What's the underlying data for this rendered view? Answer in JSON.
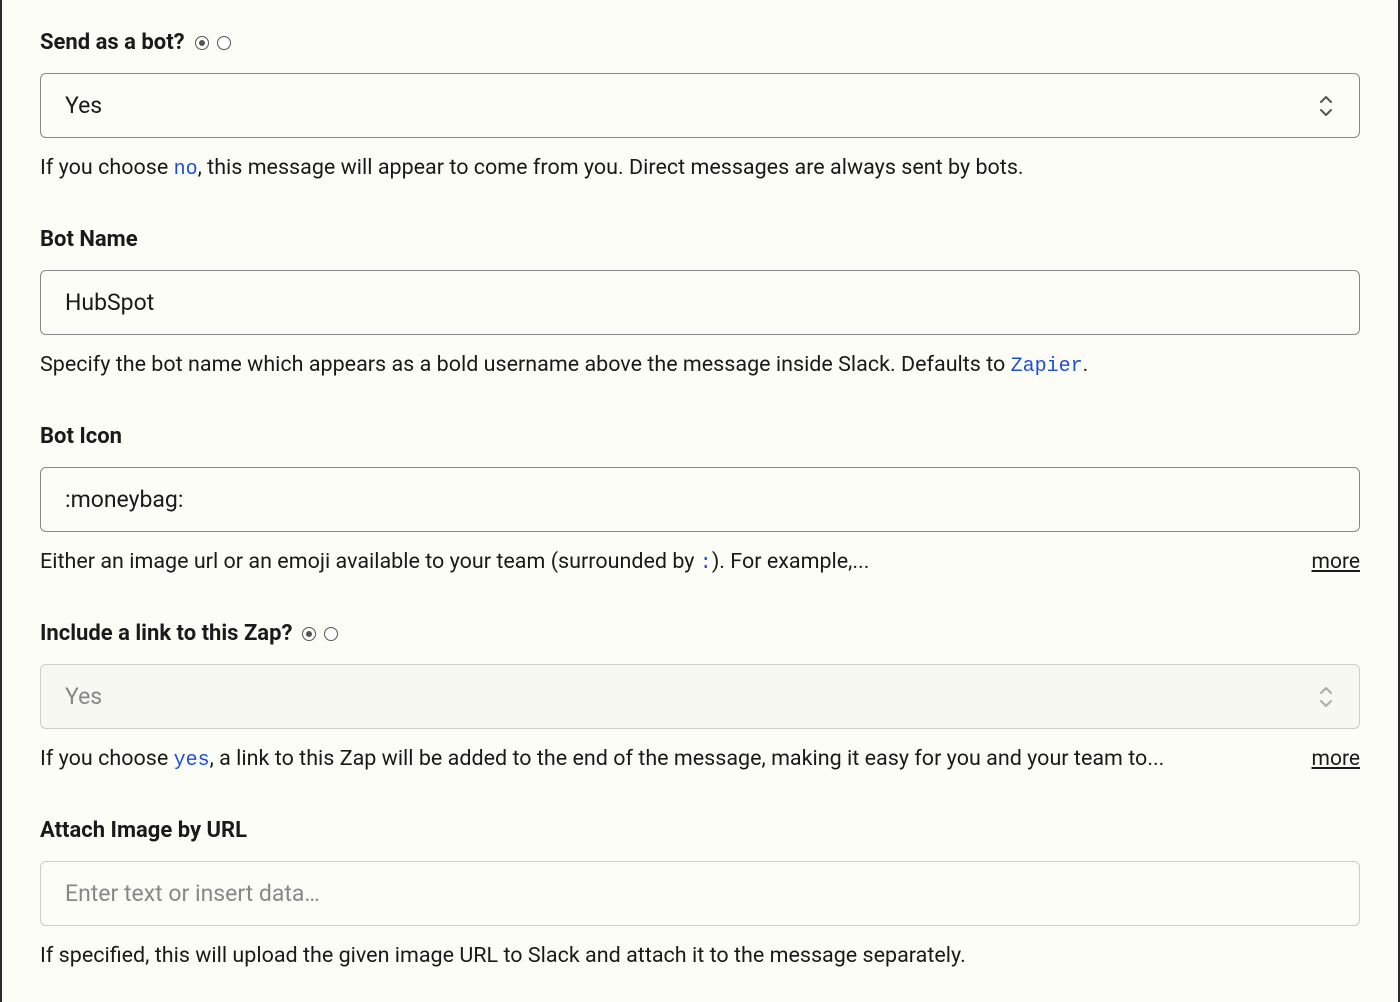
{
  "sendAsBot": {
    "label": "Send as a bot?",
    "value": "Yes",
    "helpPrefix": "If you choose ",
    "helpCode": "no",
    "helpSuffix": ", this message will appear to come from you. Direct messages are always sent by bots."
  },
  "botName": {
    "label": "Bot Name",
    "value": "HubSpot",
    "helpPrefix": "Specify the bot name which appears as a bold username above the message inside Slack. Defaults to ",
    "helpCode": "Zapier",
    "helpSuffix": "."
  },
  "botIcon": {
    "label": "Bot Icon",
    "value": ":moneybag:",
    "helpPrefix": "Either an image url or an emoji available to your team (surrounded by ",
    "helpCode": ":",
    "helpSuffix": "). For example,...",
    "moreLabel": "more"
  },
  "includeLink": {
    "label": "Include a link to this Zap?",
    "value": "Yes",
    "helpPrefix": "If you choose ",
    "helpCode": "yes",
    "helpSuffix": ", a link to this Zap will be added to the end of the message, making it easy for you and your team to...",
    "moreLabel": "more"
  },
  "attachImage": {
    "label": "Attach Image by URL",
    "placeholder": "Enter text or insert data…",
    "help": "If specified, this will upload the given image URL to Slack and attach it to the message separately."
  }
}
